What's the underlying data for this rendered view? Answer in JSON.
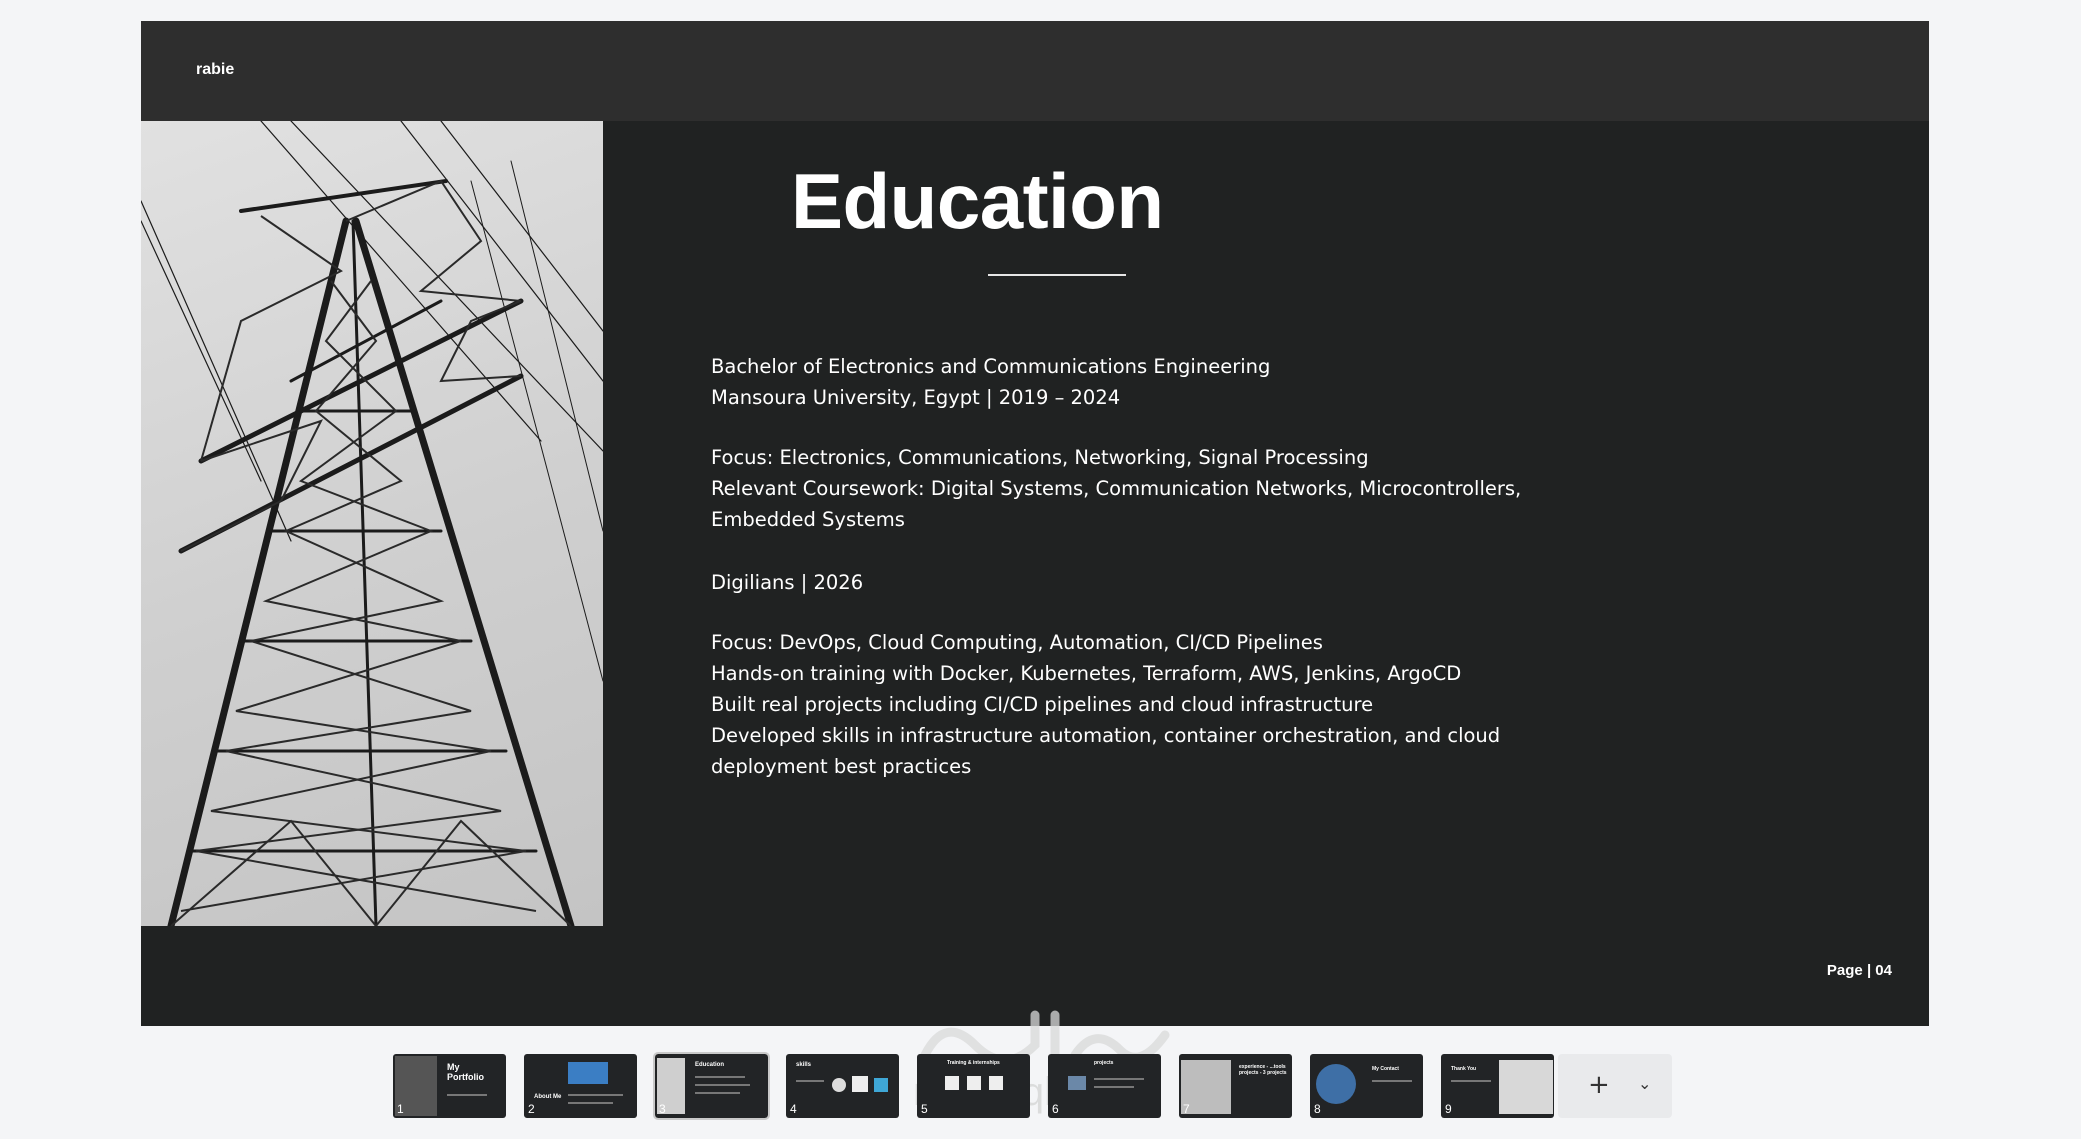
{
  "slide": {
    "brand": "rabie",
    "title": "Education",
    "page_label": "Page | 04",
    "lines": [
      "Bachelor of Electronics and Communications Engineering",
      "Mansoura University, Egypt | 2019 – 2024",
      "Focus: Electronics, Communications, Networking, Signal Processing",
      "Relevant Coursework: Digital Systems, Communication Networks, Microcontrollers,",
      "Embedded Systems",
      "Digilians  | 2026",
      "Focus: DevOps, Cloud Computing, Automation, CI/CD Pipelines",
      "Hands-on training with Docker, Kubernetes, Terraform, AWS, Jenkins, ArgoCD",
      "Built real projects including CI/CD pipelines and cloud infrastructure",
      "Developed skills in infrastructure automation, container orchestration, and cloud",
      "deployment best practices"
    ]
  },
  "thumbnails": [
    {
      "number": "1",
      "title": "My Portfolio"
    },
    {
      "number": "2",
      "title": "About Me"
    },
    {
      "number": "3",
      "title": "Education",
      "active": true
    },
    {
      "number": "4",
      "title": "skills"
    },
    {
      "number": "5",
      "title": "Training & internships"
    },
    {
      "number": "6",
      "title": "projects"
    },
    {
      "number": "7",
      "title": "experience - ...tools projects - 3 projects"
    },
    {
      "number": "8",
      "title": "My Contact"
    },
    {
      "number": "9",
      "title": "Thank You"
    }
  ],
  "toolbar": {
    "add_label": "+",
    "more_label": "⌄"
  },
  "icons": {
    "add": "plus-icon",
    "dropdown": "chevron-down-icon"
  },
  "colors": {
    "slide_bg": "#202222",
    "header_bg": "#2e2e2e",
    "page_bg": "#f4f5f7"
  }
}
